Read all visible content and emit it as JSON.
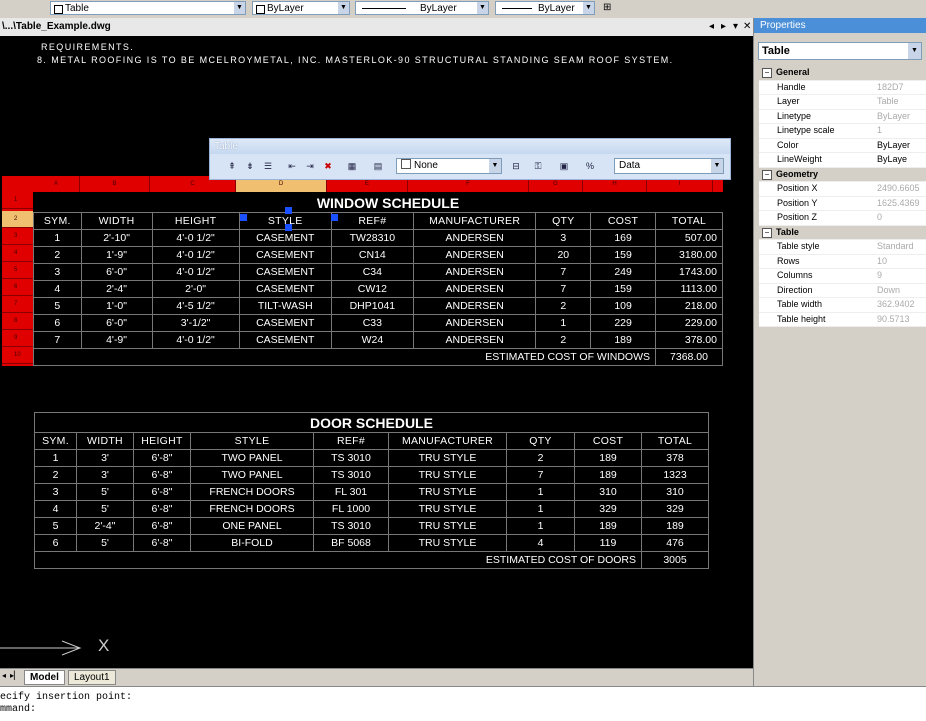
{
  "toolbar": {
    "layer_value": "Table",
    "color_value": "ByLayer",
    "linetype_value": "ByLayer",
    "lineweight_value": "ByLayer"
  },
  "document": {
    "tab_title": "\\...\\Table_Example.dwg",
    "nav_prev": "◂",
    "nav_next": "▸",
    "close": "✕"
  },
  "notes": {
    "line1": "REQUIREMENTS.",
    "line2": "8.    METAL ROOFING IS TO BE MCELROYMETAL, INC. MASTERLOK-90 STRUCTURAL STANDING SEAM ROOF SYSTEM."
  },
  "table_toolbar": {
    "title": "Table",
    "border_value": "None",
    "cell_format_value": "Data"
  },
  "grid_labels": {
    "columns": [
      "A",
      "B",
      "C",
      "D",
      "E",
      "F",
      "G",
      "H",
      "I"
    ],
    "rows": [
      "1",
      "2",
      "3",
      "4",
      "5",
      "6",
      "7",
      "8",
      "9",
      "10"
    ]
  },
  "window_schedule": {
    "title": "WINDOW SCHEDULE",
    "headers": [
      "SYM.",
      "WIDTH",
      "HEIGHT",
      "STYLE",
      "REF#",
      "MANUFACTURER",
      "QTY",
      "COST",
      "TOTAL"
    ],
    "rows": [
      [
        "1",
        "2'-10\"",
        "4'-0 1/2\"",
        "CASEMENT",
        "TW28310",
        "ANDERSEN",
        "3",
        "169",
        "507.00"
      ],
      [
        "2",
        "1'-9\"",
        "4'-0 1/2\"",
        "CASEMENT",
        "CN14",
        "ANDERSEN",
        "20",
        "159",
        "3180.00"
      ],
      [
        "3",
        "6'-0\"",
        "4'-0 1/2\"",
        "CASEMENT",
        "C34",
        "ANDERSEN",
        "7",
        "249",
        "1743.00"
      ],
      [
        "4",
        "2'-4\"",
        "2'-0\"",
        "CASEMENT",
        "CW12",
        "ANDERSEN",
        "7",
        "159",
        "1113.00"
      ],
      [
        "5",
        "1'-0\"",
        "4'-5 1/2\"",
        "TILT-WASH",
        "DHP1041",
        "ANDERSEN",
        "2",
        "109",
        "218.00"
      ],
      [
        "6",
        "6'-0\"",
        "3'-1/2\"",
        "CASEMENT",
        "C33",
        "ANDERSEN",
        "1",
        "229",
        "229.00"
      ],
      [
        "7",
        "4'-9\"",
        "4'-0 1/2\"",
        "CASEMENT",
        "W24",
        "ANDERSEN",
        "2",
        "189",
        "378.00"
      ]
    ],
    "total_label": "ESTIMATED COST OF WINDOWS",
    "total_value": "7368.00"
  },
  "door_schedule": {
    "title": "DOOR SCHEDULE",
    "headers": [
      "SYM.",
      "WIDTH",
      "HEIGHT",
      "STYLE",
      "REF#",
      "MANUFACTURER",
      "QTY",
      "COST",
      "TOTAL"
    ],
    "rows": [
      [
        "1",
        "3'",
        "6'-8\"",
        "TWO PANEL",
        "TS 3010",
        "TRU STYLE",
        "2",
        "189",
        "378"
      ],
      [
        "2",
        "3'",
        "6'-8\"",
        "TWO PANEL",
        "TS 3010",
        "TRU STYLE",
        "7",
        "189",
        "1323"
      ],
      [
        "3",
        "5'",
        "6'-8\"",
        "FRENCH DOORS",
        "FL 301",
        "TRU STYLE",
        "1",
        "310",
        "310"
      ],
      [
        "4",
        "5'",
        "6'-8\"",
        "FRENCH DOORS",
        "FL 1000",
        "TRU STYLE",
        "1",
        "329",
        "329"
      ],
      [
        "5",
        "2'-4\"",
        "6'-8\"",
        "ONE PANEL",
        "TS 3010",
        "TRU STYLE",
        "1",
        "189",
        "189"
      ],
      [
        "6",
        "5'",
        "6'-8\"",
        "BI-FOLD",
        "BF 5068",
        "TRU STYLE",
        "4",
        "119",
        "476"
      ]
    ],
    "total_label": "ESTIMATED COST OF DOORS",
    "total_value": "3005"
  },
  "ucs": {
    "x_label": "X"
  },
  "layout_tabs": {
    "model": "Model",
    "layout1": "Layout1"
  },
  "command_line": {
    "line1": "ecify insertion point:",
    "line2": "mmand:"
  },
  "properties": {
    "title": "Properties",
    "selection": "Table",
    "categories": [
      {
        "name": "General",
        "rows": [
          {
            "key": "Handle",
            "value": "182D7"
          },
          {
            "key": "Layer",
            "value": "Table"
          },
          {
            "key": "Linetype",
            "value": "ByLayer"
          },
          {
            "key": "Linetype scale",
            "value": "1"
          },
          {
            "key": "Color",
            "value": "ByLayer"
          },
          {
            "key": "LineWeight",
            "value": "ByLaye"
          }
        ]
      },
      {
        "name": "Geometry",
        "rows": [
          {
            "key": "Position X",
            "value": "2490.6605"
          },
          {
            "key": "Position Y",
            "value": "1625.4369"
          },
          {
            "key": "Position Z",
            "value": "0"
          }
        ]
      },
      {
        "name": "Table",
        "rows": [
          {
            "key": "Table style",
            "value": "Standard"
          },
          {
            "key": "Rows",
            "value": "10"
          },
          {
            "key": "Columns",
            "value": "9"
          },
          {
            "key": "Direction",
            "value": "Down"
          },
          {
            "key": "Table width",
            "value": "362.9402"
          },
          {
            "key": "Table height",
            "value": "90.5713"
          }
        ]
      }
    ]
  },
  "colors": {
    "canvas": "#000000",
    "grid_label_red": "#e00000",
    "selected_column": "#f0c070",
    "palette_header": "#4a8fd8"
  }
}
